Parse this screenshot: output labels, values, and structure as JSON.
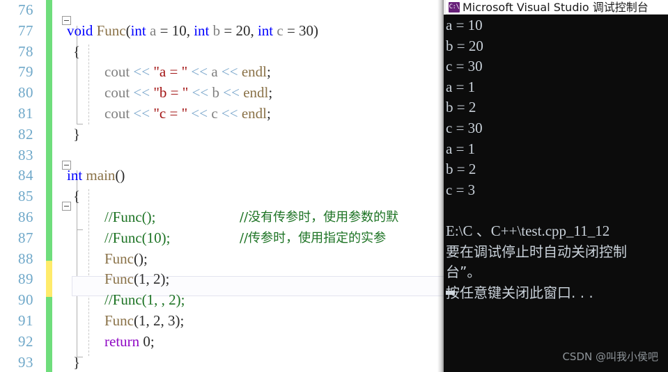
{
  "editor": {
    "name": "visual-studio-code-editor",
    "first_line_number": 76,
    "lines": [
      {
        "n": "76",
        "change": "green",
        "text": ""
      },
      {
        "n": "77",
        "change": "green",
        "text": "void Func(int a = 10, int b = 20, int c = 30)"
      },
      {
        "n": "78",
        "change": "green",
        "text": "{"
      },
      {
        "n": "79",
        "change": "green",
        "text": "    cout << \"a = \" << a << endl;"
      },
      {
        "n": "80",
        "change": "green",
        "text": "    cout << \"b = \" << b << endl;"
      },
      {
        "n": "81",
        "change": "green",
        "text": "    cout << \"c = \" << c << endl;"
      },
      {
        "n": "82",
        "change": "green",
        "text": "}"
      },
      {
        "n": "83",
        "change": "green",
        "text": ""
      },
      {
        "n": "84",
        "change": "green",
        "text": "int main()"
      },
      {
        "n": "85",
        "change": "green",
        "text": "{"
      },
      {
        "n": "86",
        "change": "green",
        "text": "    //Func();          //没有传参时，使用参数的默"
      },
      {
        "n": "87",
        "change": "green",
        "text": "    //Func(10);        //传参时，使用指定的实参"
      },
      {
        "n": "88",
        "change": "green",
        "text": "    Func();"
      },
      {
        "n": "89",
        "change": "yellow",
        "text": "    Func(1, 2);"
      },
      {
        "n": "90",
        "change": "yellow",
        "text": "    //Func(1, , 2);"
      },
      {
        "n": "91",
        "change": "green",
        "text": "    Func(1, 2, 3);"
      },
      {
        "n": "92",
        "change": "green",
        "text": "    return 0;"
      },
      {
        "n": "93",
        "change": "green",
        "text": "}"
      }
    ],
    "tokens": {
      "kw_void": "void",
      "kw_int": "int",
      "kw_return": "return",
      "fn_Func": "Func",
      "fn_main": "main",
      "id_cout": "cout",
      "id_endl": "endl",
      "id_a": "a",
      "id_b": "b",
      "id_c": "c",
      "num_10": "10",
      "num_20": "20",
      "num_30": "30",
      "num_0": "0",
      "num_1": "1",
      "num_2": "2",
      "num_3": "3",
      "str_a": "\"a = \"",
      "str_b": "\"b = \"",
      "str_c": "\"c = \"",
      "shift": "<<",
      "comment_func_call": "//Func();",
      "comment_func_call_10": "//Func(10);",
      "comment_func_call_1_2": "//Func(1, , 2);",
      "comment_cn_86": "//没有传参时，使用参数的默",
      "comment_cn_87": "//传参时，使用指定的实参"
    },
    "colors": {
      "keyword": "#0000ff",
      "function": "#8a7248",
      "identifier": "#808080",
      "string": "#a31515",
      "comment": "#1d7324",
      "control": "#8f08c4",
      "operator": "#7ba7cc",
      "line_number": "#6fa8c9",
      "change_bar_saved": "#6fdd7c",
      "change_bar_unsaved": "#ffeb6b",
      "background": "#ffffff"
    }
  },
  "console": {
    "name": "microsoft-visual-studio-debug-console",
    "title": "Microsoft Visual Studio 调试控制台",
    "icon": "cmd-console-icon",
    "icon_glyph": "C:\\",
    "background": "#0c0c0c",
    "text_color": "#c9d1d9",
    "output_lines": [
      "a = 10",
      "b = 20",
      "c = 30",
      "a = 1",
      "b = 2",
      "c = 30",
      "a = 1",
      "b = 2",
      "c = 3",
      "",
      "E:\\C 、C++\\test.cpp_11_12",
      "要在调试停止时自动关闭控制",
      "台”。",
      "按任意键关闭此窗口. . ."
    ]
  },
  "watermark": {
    "text": "CSDN @叫我小侯吧"
  }
}
